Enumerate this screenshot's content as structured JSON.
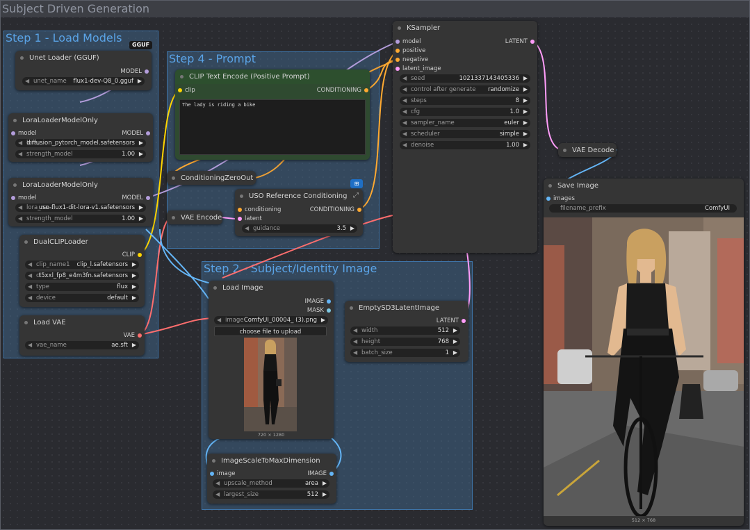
{
  "workflow_title": "Subject Driven Generation",
  "groups": {
    "step1": "Step 1 - Load Models",
    "step4": "Step 4 - Prompt",
    "step2": "Step 2 - Subject/Identity Image"
  },
  "gguf_badge": "GGUF",
  "unet_loader": {
    "title": "Unet Loader (GGUF)",
    "out": "MODEL",
    "unet_name_label": "unet_name",
    "unet_name_value": "flux1-dev-Q8_0.gguf"
  },
  "lora1": {
    "title": "LoraLoaderModelOnly",
    "in": "model",
    "out": "MODEL",
    "lora_label": "lora...",
    "lora_value": "diffusion_pytorch_model.safetensors",
    "strength_label": "strength_model",
    "strength_value": "1.00"
  },
  "lora2": {
    "title": "LoraLoaderModelOnly",
    "in": "model",
    "out": "MODEL",
    "lora_label": "lora_na...",
    "lora_value": "uso-flux1-dit-lora-v1.safetensors",
    "strength_label": "strength_model",
    "strength_value": "1.00"
  },
  "dualclip": {
    "title": "DualCLIPLoader",
    "out": "CLIP",
    "clip1_label": "clip_name1",
    "clip1_value": "clip_l.safetensors",
    "clip2_label": "cl...",
    "clip2_value": "t5xxl_fp8_e4m3fn.safetensors",
    "type_label": "type",
    "type_value": "flux",
    "device_label": "device",
    "device_value": "default"
  },
  "load_vae": {
    "title": "Load VAE",
    "out": "VAE",
    "vae_label": "vae_name",
    "vae_value": "ae.sft"
  },
  "clip_text": {
    "title": "CLIP Text Encode (Positive Prompt)",
    "in": "clip",
    "out": "CONDITIONING",
    "text": "The lady is riding a bike"
  },
  "cond_zero": {
    "title": "ConditioningZeroOut"
  },
  "vae_encode": {
    "title": "VAE Encode"
  },
  "uso_ref": {
    "title": "USO Reference Conditioning",
    "in1": "conditioning",
    "in2": "latent",
    "out": "CONDITIONING",
    "guidance_label": "guidance",
    "guidance_value": "3.5"
  },
  "ksampler": {
    "title": "KSampler",
    "inputs": [
      "model",
      "positive",
      "negative",
      "latent_image"
    ],
    "out": "LATENT",
    "widgets": [
      {
        "label": "seed",
        "value": "1021337143405336"
      },
      {
        "label": "control after generate",
        "value": "randomize"
      },
      {
        "label": "steps",
        "value": "8"
      },
      {
        "label": "cfg",
        "value": "1.0"
      },
      {
        "label": "sampler_name",
        "value": "euler"
      },
      {
        "label": "scheduler",
        "value": "simple"
      },
      {
        "label": "denoise",
        "value": "1.00"
      }
    ]
  },
  "vae_decode": {
    "title": "VAE Decode"
  },
  "save_image": {
    "title": "Save Image",
    "in": "images",
    "prefix_label": "filename_prefix",
    "prefix_value": "ComfyUI",
    "dims": "512 × 768"
  },
  "load_image": {
    "title": "Load Image",
    "out1": "IMAGE",
    "out2": "MASK",
    "image_label": "image",
    "image_value": "ComfyUI_00004_ (3).png",
    "upload_label": "choose file to upload",
    "dims": "720 × 1280"
  },
  "empty_latent": {
    "title": "EmptySD3LatentImage",
    "out": "LATENT",
    "width_label": "width",
    "width_value": "512",
    "height_label": "height",
    "height_value": "768",
    "batch_label": "batch_size",
    "batch_value": "1"
  },
  "img_scale": {
    "title": "ImageScaleToMaxDimension",
    "in": "image",
    "out": "IMAGE",
    "method_label": "upscale_method",
    "method_value": "area",
    "size_label": "largest_size",
    "size_value": "512"
  },
  "colors": {
    "model": "#b39ddb",
    "clip": "#ffd500",
    "conditioning": "#ffa931",
    "latent": "#ff9cf9",
    "vae": "#ff6e6e",
    "image": "#64b5f6",
    "group": "#3e74a8"
  }
}
